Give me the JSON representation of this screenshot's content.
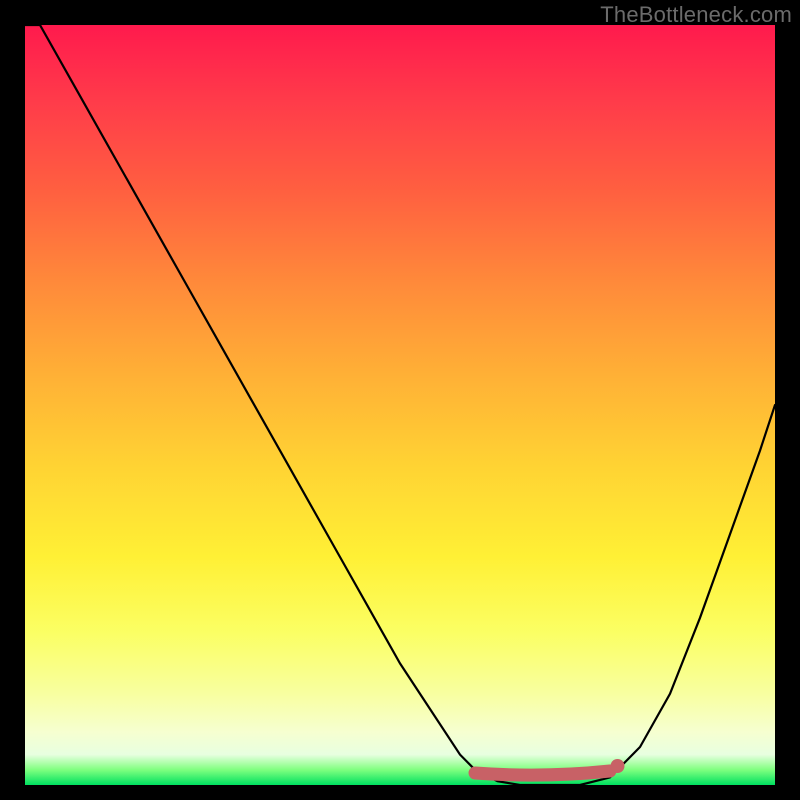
{
  "watermark": "TheBottleneck.com",
  "chart_data": {
    "type": "line",
    "title": "",
    "xlabel": "",
    "ylabel": "",
    "xlim": [
      0,
      100
    ],
    "ylim": [
      0,
      100
    ],
    "grid": false,
    "legend": false,
    "x": [
      0,
      2,
      6,
      10,
      14,
      18,
      22,
      26,
      30,
      34,
      38,
      42,
      46,
      50,
      54,
      58,
      60,
      63,
      66,
      70,
      74,
      78,
      82,
      86,
      90,
      94,
      98,
      100
    ],
    "values": [
      110,
      100,
      93,
      86,
      79,
      72,
      65,
      58,
      51,
      44,
      37,
      30,
      23,
      16,
      10,
      4,
      2,
      0.5,
      0,
      0,
      0,
      1,
      5,
      12,
      22,
      33,
      44,
      50
    ],
    "optimal_zone": {
      "start_pct": 60,
      "end_pct": 78
    },
    "indicator_dot_pct": 79,
    "gradient_colors": {
      "top": "#ff1a4d",
      "mid": "#fff035",
      "bottom": "#00e060"
    }
  }
}
